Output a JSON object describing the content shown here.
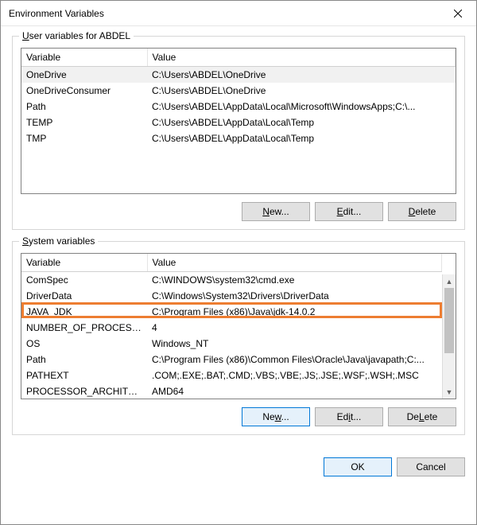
{
  "window": {
    "title": "Environment Variables"
  },
  "user_section": {
    "label_prefix": "U",
    "label_rest": "ser variables for ABDEL",
    "headers": {
      "variable": "Variable",
      "value": "Value"
    },
    "rows": [
      {
        "name": "OneDrive",
        "value": "C:\\Users\\ABDEL\\OneDrive",
        "selected": true
      },
      {
        "name": "OneDriveConsumer",
        "value": "C:\\Users\\ABDEL\\OneDrive"
      },
      {
        "name": "Path",
        "value": "C:\\Users\\ABDEL\\AppData\\Local\\Microsoft\\WindowsApps;C:\\..."
      },
      {
        "name": "TEMP",
        "value": "C:\\Users\\ABDEL\\AppData\\Local\\Temp"
      },
      {
        "name": "TMP",
        "value": "C:\\Users\\ABDEL\\AppData\\Local\\Temp"
      }
    ],
    "buttons": {
      "new_u": "N",
      "new_rest": "ew...",
      "edit_u": "E",
      "edit_rest": "dit...",
      "delete_u": "D",
      "delete_rest": "elete"
    }
  },
  "system_section": {
    "label_prefix": "S",
    "label_rest": "ystem variables",
    "headers": {
      "variable": "Variable",
      "value": "Value"
    },
    "rows": [
      {
        "name": "ComSpec",
        "value": "C:\\WINDOWS\\system32\\cmd.exe"
      },
      {
        "name": "DriverData",
        "value": "C:\\Windows\\System32\\Drivers\\DriverData"
      },
      {
        "name": "JAVA_JDK",
        "value": "C:\\Program Files (x86)\\Java\\jdk-14.0.2",
        "highlighted": true
      },
      {
        "name": "NUMBER_OF_PROCESSORS",
        "value": "4"
      },
      {
        "name": "OS",
        "value": "Windows_NT"
      },
      {
        "name": "Path",
        "value": "C:\\Program Files (x86)\\Common Files\\Oracle\\Java\\javapath;C:..."
      },
      {
        "name": "PATHEXT",
        "value": ".COM;.EXE;.BAT;.CMD;.VBS;.VBE;.JS;.JSE;.WSF;.WSH;.MSC"
      },
      {
        "name": "PROCESSOR_ARCHITECTU...",
        "value": "AMD64"
      }
    ],
    "buttons": {
      "new_u": "w",
      "new_pre": "Ne",
      "new_post": "...",
      "edit_u": "i",
      "edit_pre": "Ed",
      "edit_post": "t...",
      "delete_u": "L",
      "delete_pre": "De",
      "delete_post": "ete"
    }
  },
  "footer": {
    "ok": "OK",
    "cancel": "Cancel"
  }
}
